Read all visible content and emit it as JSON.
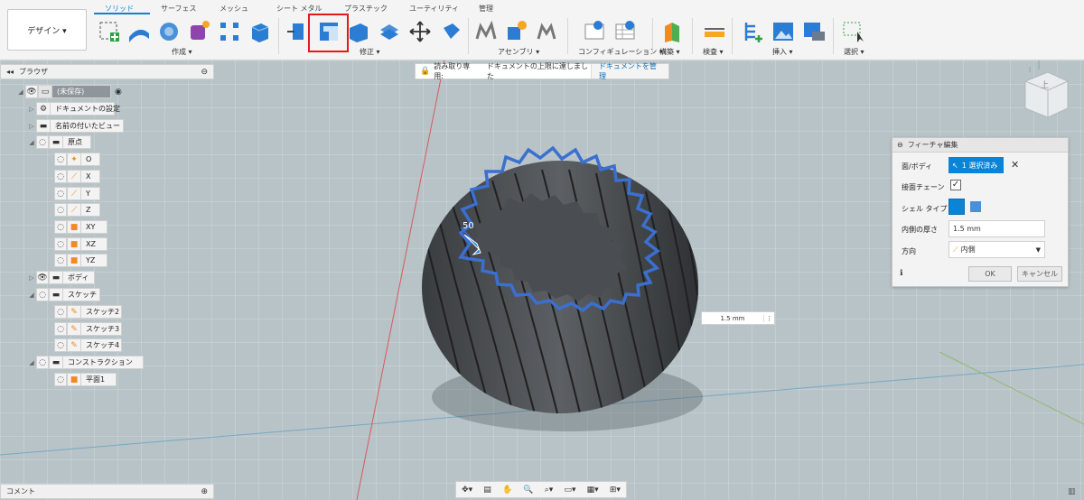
{
  "toolbar": {
    "workspace_label": "デザイン ▾",
    "tabs": [
      "ソリッド",
      "サーフェス",
      "メッシュ",
      "シート メタル",
      "プラスチック",
      "ユーティリティ",
      "管理"
    ],
    "groups": [
      "作成 ▾",
      "修正 ▾",
      "アセンブリ ▾",
      "コンフィギュレーション ▾",
      "構築 ▾",
      "検査 ▾",
      "挿入 ▾",
      "選択 ▾"
    ]
  },
  "browser": {
    "title": "ブラウザ",
    "root": "(未保存)",
    "items": [
      "ドキュメントの設定",
      "名前の付いたビュー",
      "原点",
      "O",
      "X",
      "Y",
      "Z",
      "XY",
      "XZ",
      "YZ",
      "ボディ",
      "スケッチ",
      "スケッチ2",
      "スケッチ3",
      "スケッチ4",
      "コンストラクション",
      "平面1"
    ]
  },
  "banner": {
    "prefix": "読み取り専用:",
    "message": "ドキュメントの上限に達しました",
    "action": "ドキュメントを管理"
  },
  "dialog": {
    "title": "フィーチャ編集",
    "face_body_label": "面/ボディ",
    "selection": "1 選択済み",
    "tangent_label": "接面チェーン",
    "shell_type_label": "シェル タイプ",
    "thickness_label": "内側の厚さ",
    "thickness_value": "1.5 mm",
    "direction_label": "方向",
    "direction_value": "内側",
    "ok": "OK",
    "cancel": "キャンセル"
  },
  "viewport": {
    "field_value": "1.5 mm",
    "dimension_label": "50"
  },
  "viewcube_label": "上",
  "comments": "コメント",
  "colors": {
    "accent": "#0a84d6",
    "highlight": "#e4191b",
    "outline": "#3b6fd0"
  }
}
